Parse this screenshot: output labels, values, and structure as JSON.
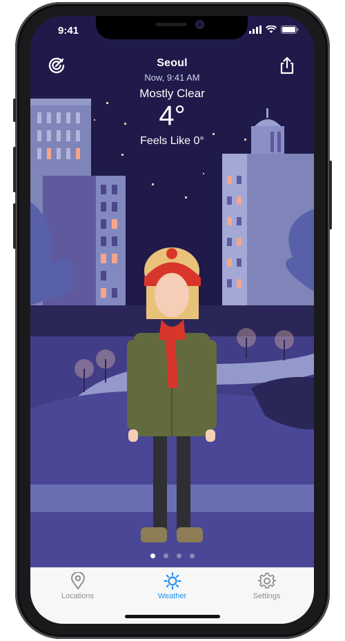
{
  "status_bar": {
    "time": "9:41"
  },
  "header": {
    "city": "Seoul",
    "updated": "Now, 9:41 AM",
    "condition": "Mostly Clear",
    "temperature": "4°",
    "feels_like": "Feels Like 0°"
  },
  "toolbar": {
    "left_icon": "radar-icon",
    "right_icon": "share-icon"
  },
  "pager": {
    "count": 4,
    "active_index": 0
  },
  "tabs": [
    {
      "label": "Locations",
      "icon": "location-pin-icon",
      "active": false
    },
    {
      "label": "Weather",
      "icon": "sun-icon",
      "active": true
    },
    {
      "label": "Settings",
      "icon": "gear-icon",
      "active": false
    }
  ],
  "colors": {
    "sky": "#1f1a4a",
    "accent": "#1f8ef1",
    "moon": "#f6c8ae",
    "inactive_tab": "#8e8e93"
  }
}
